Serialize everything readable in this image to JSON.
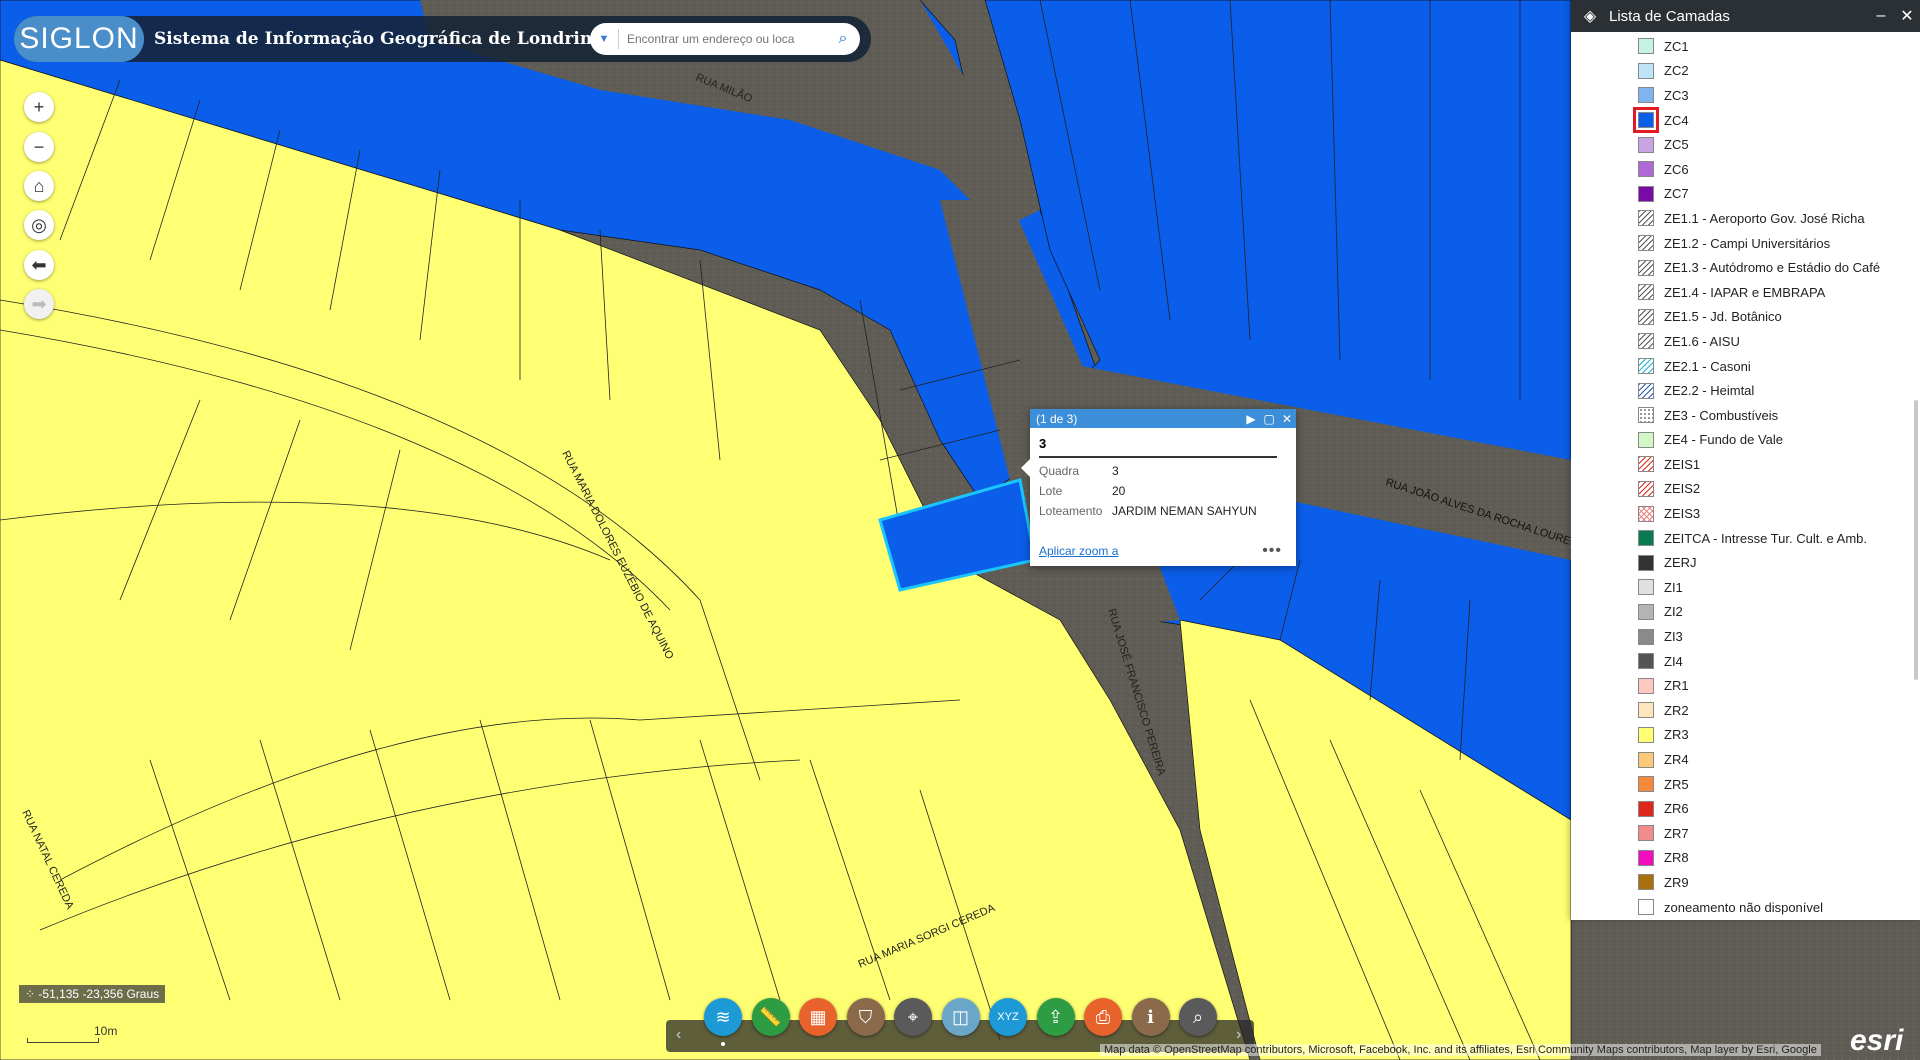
{
  "header": {
    "logo": "SIGLON",
    "title": "Sistema de Informação Geográfica de Londrina",
    "search_placeholder": "Encontrar um endereço ou loca"
  },
  "map": {
    "streets": [
      "RUA MILÃO",
      "RUA JOÃO ALVES DA ROCHA LOURE",
      "RUA MARIA DOLORES EUZÉBIO DE AQUINO",
      "RUA JOSÉ FRANCISCO PEREIRA",
      "RUA MARIA SORGI CEREDA",
      "RUA NATAL CEREDA"
    ],
    "colors": {
      "zr3": "#ffff73",
      "zc4": "#0a5eea",
      "selected": "#1ac6ff"
    }
  },
  "tools": [
    "zoom-in",
    "zoom-out",
    "home",
    "locate",
    "back",
    "forward"
  ],
  "panel": {
    "title": "Lista de Camadas",
    "items": [
      {
        "label": "ZC1",
        "color": "#c6f2e4",
        "pattern": ""
      },
      {
        "label": "ZC2",
        "color": "#bfe4f7",
        "pattern": ""
      },
      {
        "label": "ZC3",
        "color": "#7fb4f0",
        "pattern": ""
      },
      {
        "label": "ZC4",
        "color": "#0a5eea",
        "pattern": "",
        "highlight": true
      },
      {
        "label": "ZC5",
        "color": "#c9a4e3",
        "pattern": ""
      },
      {
        "label": "ZC6",
        "color": "#b068d6",
        "pattern": ""
      },
      {
        "label": "ZC7",
        "color": "#7a0aa6",
        "pattern": ""
      },
      {
        "label": "ZE1.1 - Aeroporto Gov. José Richa",
        "color": "#ffffff",
        "pattern": "hatch"
      },
      {
        "label": "ZE1.2 - Campi Universitários",
        "color": "#ffffff",
        "pattern": "hatch"
      },
      {
        "label": "ZE1.3 - Autódromo e Estádio do Café",
        "color": "#ffffff",
        "pattern": "hatch"
      },
      {
        "label": "ZE1.4 - IAPAR e EMBRAPA",
        "color": "#ffffff",
        "pattern": "hatch"
      },
      {
        "label": "ZE1.5 - Jd. Botânico",
        "color": "#ffffff",
        "pattern": "hatch"
      },
      {
        "label": "ZE1.6 - AISU",
        "color": "#ffffff",
        "pattern": "hatch"
      },
      {
        "label": "ZE2.1 - Casoni",
        "color": "#ffffff",
        "pattern": "hatch-cyan"
      },
      {
        "label": "ZE2.2 - Heimtal",
        "color": "#ffffff",
        "pattern": "hatch-blue"
      },
      {
        "label": "ZE3 - Combustíveis",
        "color": "#ffffff",
        "pattern": "dots"
      },
      {
        "label": "ZE4 - Fundo de Vale",
        "color": "#d4f7c8",
        "pattern": ""
      },
      {
        "label": "ZEIS1",
        "color": "#ffffff",
        "pattern": "hatch-red"
      },
      {
        "label": "ZEIS2",
        "color": "#ffffff",
        "pattern": "hatch-red"
      },
      {
        "label": "ZEIS3",
        "color": "#ffffff",
        "pattern": "cross-red"
      },
      {
        "label": "ZEITCA - Intresse Tur. Cult. e Amb.",
        "color": "#0a7a50",
        "pattern": ""
      },
      {
        "label": "ZERJ",
        "color": "#333333",
        "pattern": ""
      },
      {
        "label": "ZI1",
        "color": "#e0e0e0",
        "pattern": ""
      },
      {
        "label": "ZI2",
        "color": "#b4b4b4",
        "pattern": ""
      },
      {
        "label": "ZI3",
        "color": "#8a8a8a",
        "pattern": ""
      },
      {
        "label": "ZI4",
        "color": "#555555",
        "pattern": ""
      },
      {
        "label": "ZR1",
        "color": "#fcc8c0",
        "pattern": ""
      },
      {
        "label": "ZR2",
        "color": "#fde6be",
        "pattern": ""
      },
      {
        "label": "ZR3",
        "color": "#ffff73",
        "pattern": ""
      },
      {
        "label": "ZR4",
        "color": "#fbc87a",
        "pattern": ""
      },
      {
        "label": "ZR5",
        "color": "#f58a3c",
        "pattern": ""
      },
      {
        "label": "ZR6",
        "color": "#e0281a",
        "pattern": ""
      },
      {
        "label": "ZR7",
        "color": "#f28c8c",
        "pattern": ""
      },
      {
        "label": "ZR8",
        "color": "#f20cc0",
        "pattern": ""
      },
      {
        "label": "ZR9",
        "color": "#a8700f",
        "pattern": ""
      },
      {
        "label": "zoneamento não disponível",
        "color": "#ffffff",
        "pattern": ""
      }
    ]
  },
  "popup": {
    "count": "(1 de 3)",
    "title": "3",
    "attrs": [
      {
        "key": "Quadra",
        "value": "3"
      },
      {
        "key": "Lote",
        "value": "20"
      },
      {
        "key": "Loteamento",
        "value": "JARDIM NEMAN SAHYUN"
      }
    ],
    "zoom_link": "Aplicar zoom a",
    "more": "•••"
  },
  "coords": "-51,135 -23,356 Graus",
  "scale": "10m",
  "toolbar": {
    "buttons": [
      {
        "name": "layers",
        "color": "#1d9ad6",
        "glyph": "≋"
      },
      {
        "name": "measure",
        "color": "#2e9c43",
        "glyph": "📏"
      },
      {
        "name": "basemap",
        "color": "#e8632b",
        "glyph": "▦"
      },
      {
        "name": "filter",
        "color": "#8a6a4b",
        "glyph": "⛉"
      },
      {
        "name": "locate",
        "color": "#5a5a5a",
        "glyph": "⌖"
      },
      {
        "name": "swipe",
        "color": "#6aa6c8",
        "glyph": "◫"
      },
      {
        "name": "coordinates",
        "color": "#1d9ad6",
        "glyph": "XYZ"
      },
      {
        "name": "share",
        "color": "#2e9c43",
        "glyph": "⇪"
      },
      {
        "name": "print",
        "color": "#e8632b",
        "glyph": "⎙"
      },
      {
        "name": "info",
        "color": "#8a6a4b",
        "glyph": "i"
      },
      {
        "name": "search",
        "color": "#5a5a5a",
        "glyph": "⌕"
      }
    ]
  },
  "attribution": "Map data © OpenStreetMap contributors, Microsoft, Facebook, Inc. and its affiliates, Esri Community Maps contributors, Map layer by Esri, Google",
  "esri": "esri"
}
